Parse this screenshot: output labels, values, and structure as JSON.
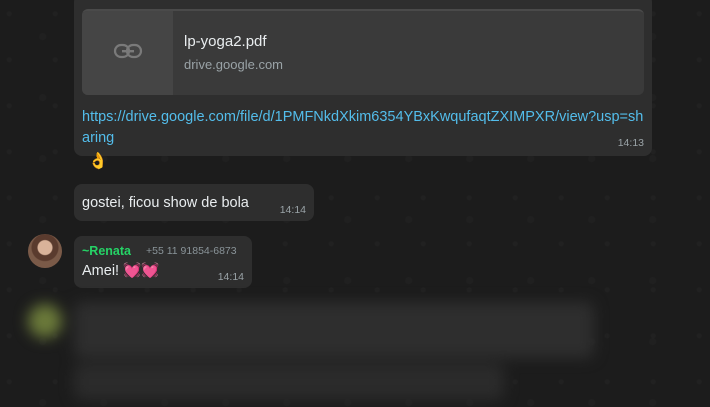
{
  "messages": {
    "link_message": {
      "preview_title": "lp-yoga2.pdf",
      "preview_domain": "drive.google.com",
      "link_text": "https://drive.google.com/file/d/1PMFNkdXkim6354YBxKwqufaqtZXIMPXR/view?usp=sharing",
      "time": "14:13",
      "reaction": "👌",
      "link_icon": "link-icon"
    },
    "reply_message": {
      "text": "gostei, ficou show de bola",
      "time": "14:14"
    },
    "renata_message": {
      "sender": "~Renata",
      "phone": "+55 11 91854-6873",
      "text": "Amei! 💓💓",
      "time": "14:14"
    }
  },
  "colors": {
    "background": "#1c1c1c",
    "bubble": "#2e2e2e",
    "link": "#53bdeb",
    "sender_name": "#25d366"
  }
}
